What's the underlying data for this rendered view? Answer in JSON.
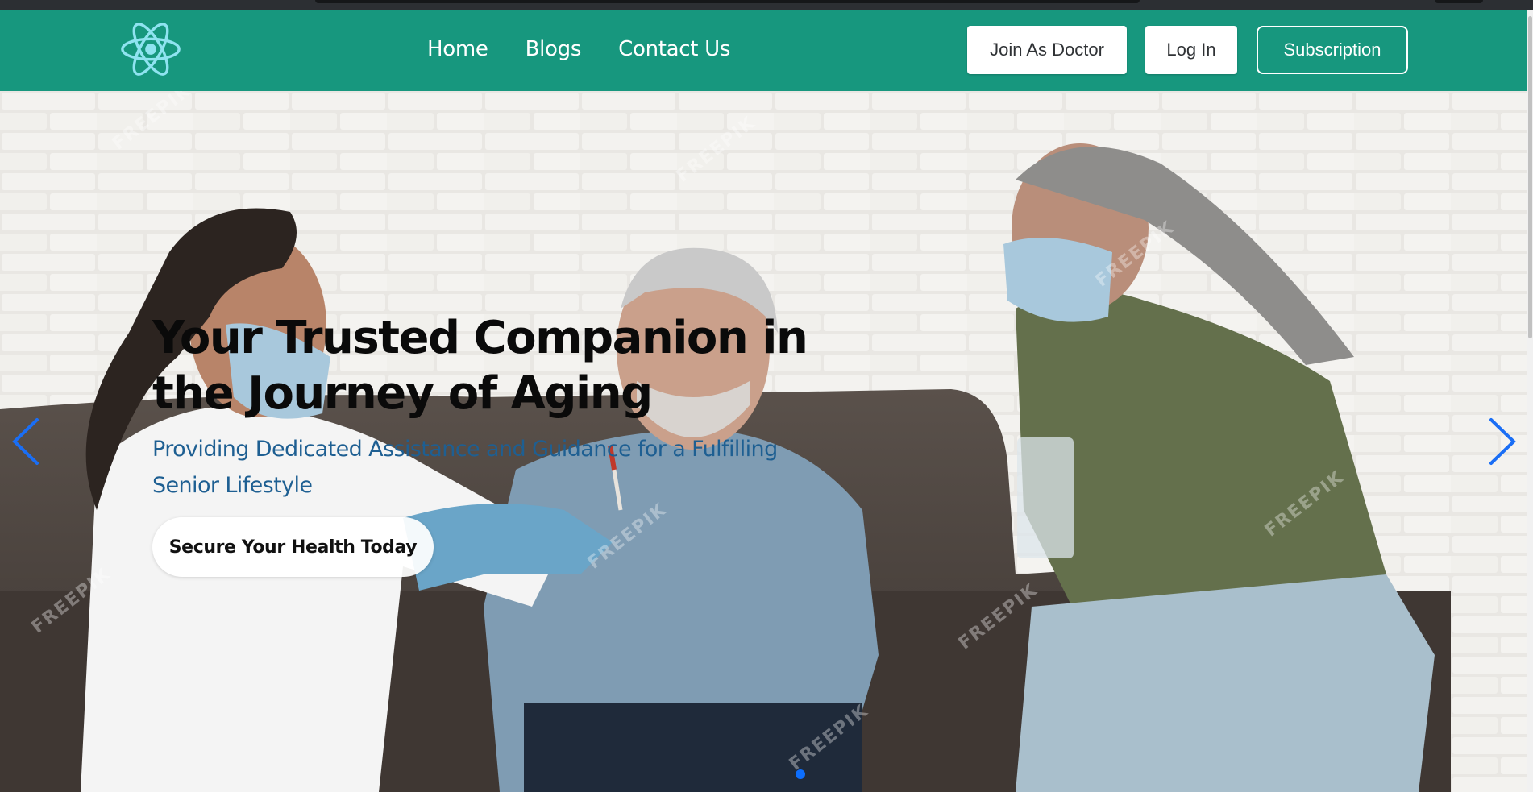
{
  "navbar": {
    "logo_icon": "react-atom-icon",
    "links": [
      "Home",
      "Blogs",
      "Contact Us"
    ],
    "join_label": "Join As Doctor",
    "login_label": "Log In",
    "subscription_label": "Subscription",
    "bg_color": "#17977e"
  },
  "hero": {
    "title": "Your Trusted Companion in the Journey of Aging",
    "subtitle": "Providing Dedicated Assistance and Guidance for a Fulfilling Senior Lifestyle",
    "cta_label": "Secure Your Health Today",
    "watermark": "FREEPIK",
    "prev_icon": "chevron-left-icon",
    "next_icon": "chevron-right-icon",
    "accent_color": "#0d6efd",
    "subtitle_color": "#1e5f92"
  }
}
